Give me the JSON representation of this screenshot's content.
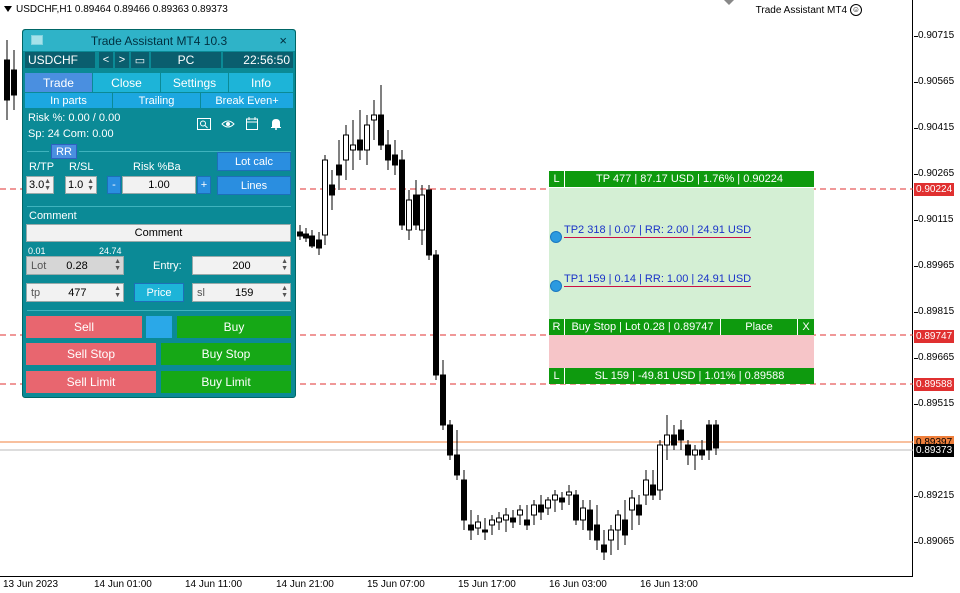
{
  "chart": {
    "symbol_title": "USDCHF,H1  0.89464 0.89466 0.89363 0.89373",
    "ea_label": "Trade Assistant MT4",
    "smiley_icon": "smiley-icon",
    "price_labels": [
      "0.90715",
      "0.90565",
      "0.90415",
      "0.90265",
      "0.90115",
      "0.89965",
      "0.89815",
      "0.89665",
      "0.89515",
      "0.89365",
      "0.89215",
      "0.89065"
    ],
    "price_tags": {
      "tp": "0.90224",
      "entry": "0.89747",
      "sl": "0.89588",
      "bid": "0.89397",
      "current": "0.89373"
    },
    "time_labels": [
      "13 Jun 2023",
      "14 Jun 01:00",
      "14 Jun 11:00",
      "14 Jun 21:00",
      "15 Jun 07:00",
      "15 Jun 17:00",
      "16 Jun 03:00",
      "16 Jun 13:00"
    ],
    "tp_bar": {
      "l": "L",
      "text": "TP 477 | 87.17 USD | 1.76% | 0.90224"
    },
    "tp2_label": "TP2 318 | 0.07 | RR: 2.00 | 24.91 USD",
    "tp1_label": "TP1 159 | 0.14 | RR: 1.00 | 24.91 USD",
    "order_bar": {
      "r": "R",
      "text": "Buy Stop | Lot 0.28 | 0.89747",
      "place": "Place",
      "x": "X"
    },
    "sl_bar": {
      "l": "L",
      "text": "SL 159 | -49.81 USD | 1.01% | 0.89588"
    },
    "colors": {
      "tp_zone": "#d4efd4",
      "sl_zone": "#f6c5c8",
      "bar_green": "#0e9a0e",
      "dashed": "#e03030"
    }
  },
  "panel": {
    "title": "Trade Assistant MT4 10.3",
    "close": "×",
    "symbol": "USDCHF",
    "nav_prev": "<",
    "nav_next": ">",
    "folder_icon": "folder-icon",
    "mode": "PC",
    "time": "22:56:50",
    "tabs": [
      "Trade",
      "Close",
      "Settings",
      "Info"
    ],
    "subtabs": [
      "In parts",
      "Trailing",
      "Break Even+"
    ],
    "risk_line": "Risk %: 0.00 /  0.00",
    "spread_line": "Sp: 24  Com: 0.00",
    "icons": [
      "search-icon",
      "eye-icon",
      "calendar-icon",
      "bell-icon"
    ],
    "rr_button": "RR",
    "r_tp_label": "R/TP",
    "r_sl_label": "R/SL",
    "risk_ba_label": "Risk %Ba",
    "lot_calc": "Lot calc",
    "r_tp_value": "3.0",
    "r_sl_value": "1.0",
    "minus": "-",
    "risk_value": "1.00",
    "plus": "+",
    "lines_button": "Lines",
    "comment_label": "Comment",
    "comment_value": "Comment",
    "lot_min": "0.01",
    "lot_max": "24.74",
    "lot_label": "Lot",
    "lot_value": "0.28",
    "entry_label": "Entry:",
    "entry_value": "200",
    "tp_label": "tp",
    "tp_value": "477",
    "price_button": "Price",
    "sl_label": "sl",
    "sl_value": "159",
    "sell": "Sell",
    "buy": "Buy",
    "sell_stop": "Sell Stop",
    "buy_stop": "Buy Stop",
    "sell_limit": "Sell Limit",
    "buy_limit": "Buy Limit"
  }
}
